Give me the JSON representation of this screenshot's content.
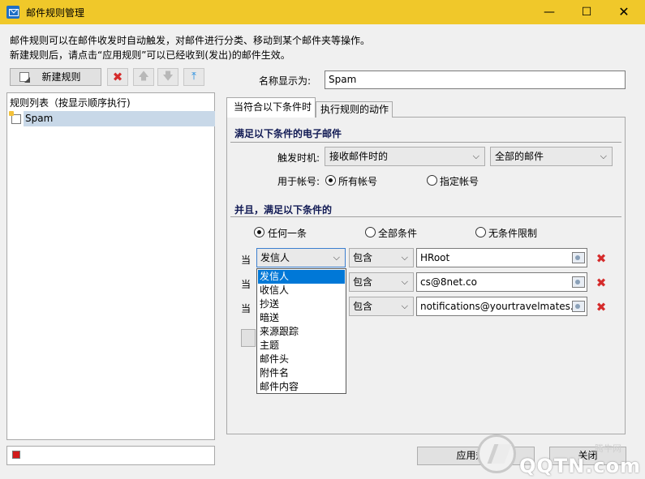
{
  "window": {
    "title": "邮件规则管理",
    "minimize": "—",
    "maximize": "☐",
    "close": "✕"
  },
  "description": {
    "line1": "邮件规则可以在邮件收发时自动触发，对邮件进行分类、移动到某个邮件夹等操作。",
    "line2": "新建规则后，请点击“应用规则”可以已经收到(发出)的邮件生效。"
  },
  "toolbar": {
    "new_rule_label": "新建规则",
    "delete_icon": "✖",
    "up_icon": "🡅",
    "down_icon": "🡇",
    "top_icon": "⤒"
  },
  "rule_list": {
    "header": "规则列表（按显示顺序执行)",
    "items": [
      {
        "label": "Spam",
        "checked": false
      }
    ]
  },
  "name": {
    "label": "名称显示为:",
    "value": "Spam"
  },
  "tabs": {
    "conditions": "当符合以下条件时",
    "actions": "执行规则的动作"
  },
  "section1": {
    "title": "满足以下条件的电子邮件",
    "trigger_label": "触发时机:",
    "trigger_value": "接收邮件时的",
    "scope_value": "全部的邮件",
    "account_label": "用于帐号:",
    "account_all": "所有帐号",
    "account_specific": "指定帐号"
  },
  "section2": {
    "title": "并且，满足以下条件的",
    "match_any": "任何一条",
    "match_all": "全部条件",
    "match_none": "无条件限制"
  },
  "conditions": [
    {
      "when": "当",
      "field": "发信人",
      "operator": "包含",
      "value": "HRoot"
    },
    {
      "when": "当",
      "field": "",
      "operator": "包含",
      "value": "cs@8net.co"
    },
    {
      "when": "当",
      "field": "",
      "operator": "包含",
      "value": "notifications@yourtravelmates.co"
    }
  ],
  "field_dropdown": {
    "options": [
      "发信人",
      "收信人",
      "抄送",
      "暗送",
      "来源跟踪",
      "主题",
      "邮件头",
      "附件名",
      "邮件内容"
    ],
    "selected_index": 0
  },
  "footer": {
    "apply_rule": "应用规则",
    "close": "关闭"
  },
  "watermark": {
    "text": "QQTN.com",
    "cn": "腾牛网"
  },
  "colors": {
    "titlebar": "#f0c82a",
    "selection": "#0078d7",
    "delete": "#d52b2b",
    "section_title": "#111a54"
  }
}
